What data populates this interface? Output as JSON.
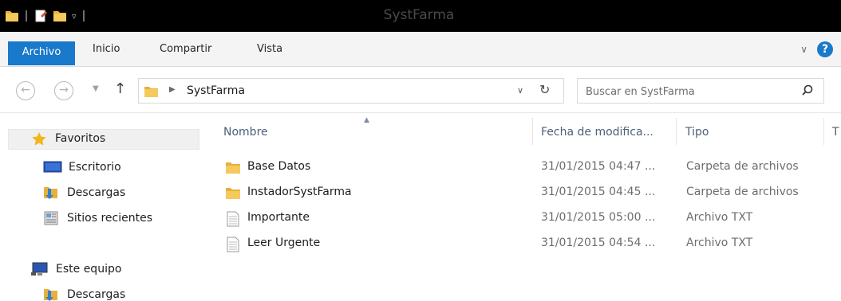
{
  "window": {
    "title": "SystFarma"
  },
  "ribbon": {
    "tabs": [
      "Archivo",
      "Inicio",
      "Compartir",
      "Vista"
    ],
    "help_label": "?"
  },
  "navigation": {
    "path": "SystFarma",
    "search_placeholder": "Buscar en SystFarma"
  },
  "sidebar": {
    "favorites_label": "Favoritos",
    "favorites": [
      "Escritorio",
      "Descargas",
      "Sitios recientes"
    ],
    "computer_label": "Este equipo",
    "computer_items": [
      "Descargas"
    ]
  },
  "list": {
    "columns": [
      "Nombre",
      "Fecha de modifica...",
      "Tipo",
      "T"
    ],
    "rows": [
      {
        "name": "Base Datos",
        "date": "31/01/2015 04:47 ...",
        "type": "Carpeta de archivos",
        "icon": "folder-icon"
      },
      {
        "name": "InstadorSystFarma",
        "date": "31/01/2015 04:45 ...",
        "type": "Carpeta de archivos",
        "icon": "folder-icon"
      },
      {
        "name": "Importante",
        "date": "31/01/2015 05:00 ...",
        "type": "Archivo TXT",
        "icon": "text-file-icon"
      },
      {
        "name": "Leer Urgente",
        "date": "31/01/2015 04:54 ...",
        "type": "Archivo TXT",
        "icon": "text-file-icon"
      }
    ]
  },
  "colors": {
    "accent": "#1979ca",
    "folder": "#e8b13a",
    "titlebar": "#000000"
  }
}
